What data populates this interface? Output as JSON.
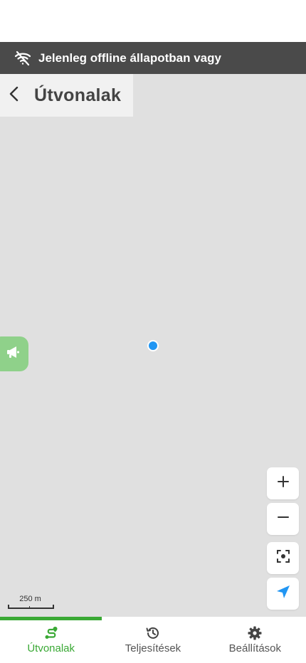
{
  "offline_banner": {
    "icon": "wifi-off-icon",
    "text": "Jelenleg offline állapotban vagy"
  },
  "header": {
    "back_icon": "chevron-left-icon",
    "title": "Útvonalak"
  },
  "map": {
    "feedback_icon": "megaphone-icon",
    "scale_label": "250 m",
    "controls": {
      "zoom_in_icon": "plus-icon",
      "zoom_out_icon": "minus-icon",
      "recenter_icon": "focus-icon",
      "locate_icon": "navigation-arrow-icon"
    }
  },
  "bottom_nav": {
    "items": [
      {
        "label": "Útvonalak",
        "icon": "route-icon",
        "active": true
      },
      {
        "label": "Teljesítések",
        "icon": "history-icon",
        "active": false
      },
      {
        "label": "Beállítások",
        "icon": "gear-icon",
        "active": false
      }
    ]
  },
  "colors": {
    "accent": "#3aa935",
    "banner_bg": "#4a4a4a",
    "map_bg": "#e0e0e0",
    "location_dot": "#2196f3",
    "locate_arrow": "#2196f3",
    "feedback_tab": "#8fd18a"
  }
}
